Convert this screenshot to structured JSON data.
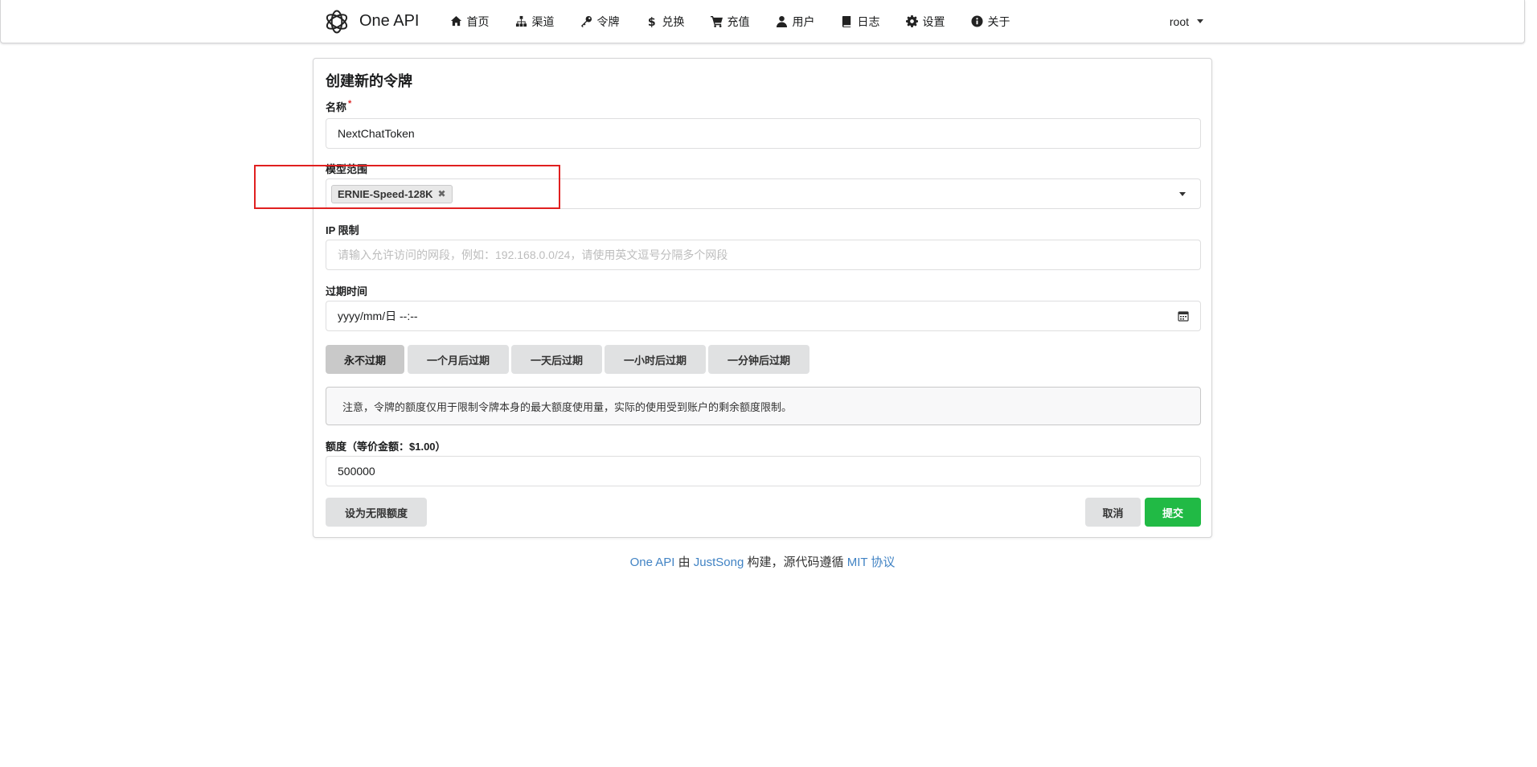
{
  "app": {
    "name": "One API"
  },
  "nav": {
    "items": [
      {
        "label": "首页",
        "icon": "home-icon"
      },
      {
        "label": "渠道",
        "icon": "sitemap-icon"
      },
      {
        "label": "令牌",
        "icon": "key-icon"
      },
      {
        "label": "兑换",
        "icon": "dollar-icon"
      },
      {
        "label": "充值",
        "icon": "cart-icon"
      },
      {
        "label": "用户",
        "icon": "user-icon"
      },
      {
        "label": "日志",
        "icon": "book-icon"
      },
      {
        "label": "设置",
        "icon": "gear-icon"
      },
      {
        "label": "关于",
        "icon": "info-icon"
      }
    ],
    "user": "root"
  },
  "form": {
    "title": "创建新的令牌",
    "name_label": "名称",
    "name_required": "*",
    "name_value": "NextChatToken",
    "models_label": "模型范围",
    "models_selected": [
      "ERNIE-Speed-128K"
    ],
    "ip_label": "IP 限制",
    "ip_placeholder": "请输入允许访问的网段，例如：192.168.0.0/24，请使用英文逗号分隔多个网段",
    "expire_label": "过期时间",
    "expire_value": "yyyy/mm/日 --:--",
    "expire_buttons": [
      "永不过期",
      "一个月后过期",
      "一天后过期",
      "一小时后过期",
      "一分钟后过期"
    ],
    "notice": "注意，令牌的额度仅用于限制令牌本身的最大额度使用量，实际的使用受到账户的剩余额度限制。",
    "quota_label": "额度（等价金额：$1.00）",
    "quota_value": "500000",
    "unlimited_button": "设为无限额度",
    "cancel_button": "取消",
    "submit_button": "提交"
  },
  "footer": {
    "brand_link": "One API",
    "by": "由",
    "author_link": "JustSong",
    "built": "构建，源代码遵循",
    "license_link": "MIT 协议"
  },
  "colors": {
    "primary": "#21ba45",
    "link": "#4183c4",
    "highlight": "#e02020",
    "required": "#db2828"
  }
}
